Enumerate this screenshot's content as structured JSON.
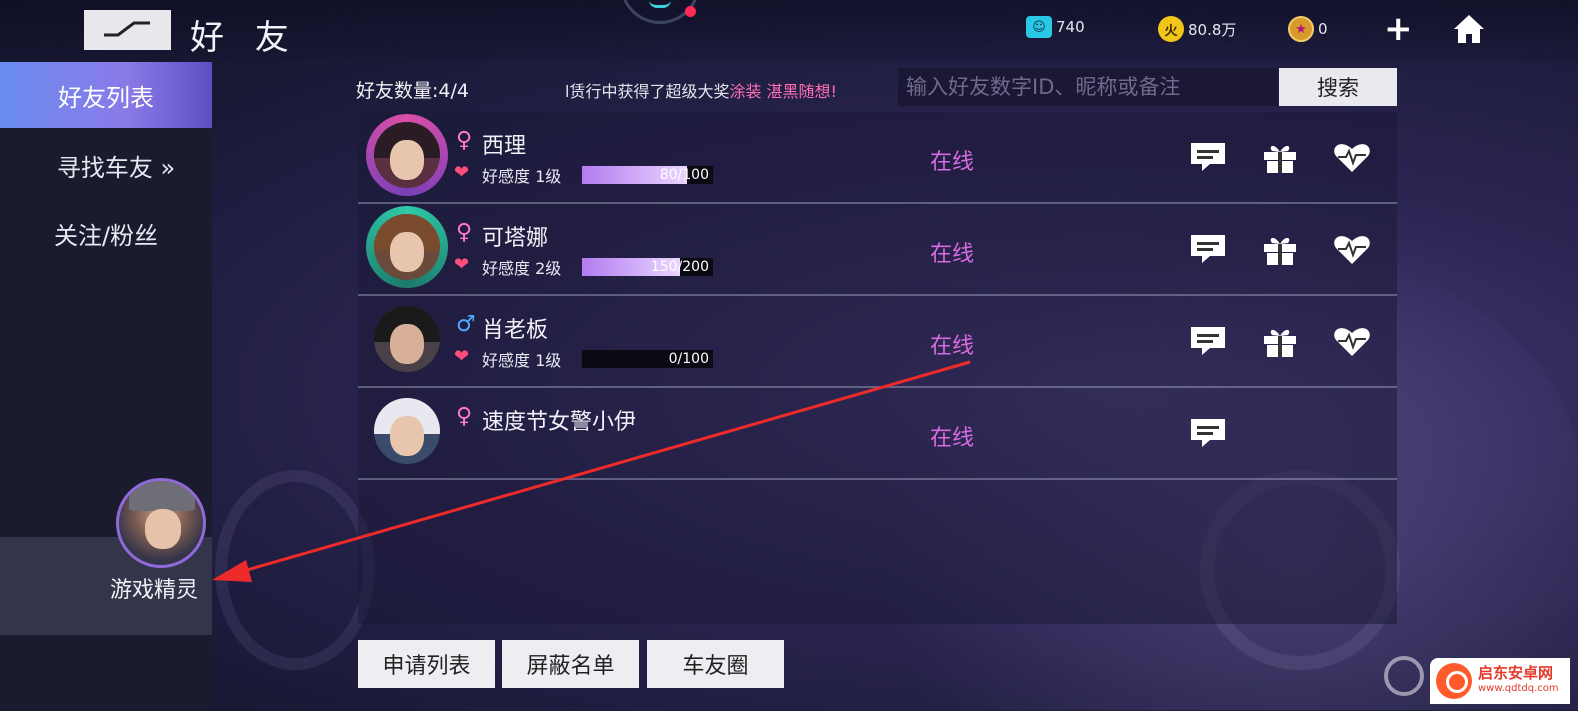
{
  "header": {
    "title": "好 友",
    "currencies": [
      {
        "icon": "ticket-icon",
        "value": "740"
      },
      {
        "icon": "gold-coin-icon",
        "value": "80.8万"
      },
      {
        "icon": "star-coin-icon",
        "value": "0"
      }
    ]
  },
  "sidebar": {
    "items": [
      {
        "label": "好友列表"
      },
      {
        "label": "寻找车友 »"
      },
      {
        "label": "关注/粉丝"
      }
    ],
    "sprite_label": "游戏精灵"
  },
  "main": {
    "count_label": "好友数量:4/4",
    "marquee_prefix": "l赁行中获得了超级大奖",
    "marquee_highlight": "涂装 湛黑随想!",
    "search_placeholder": "输入好友数字ID、昵称或备注",
    "search_button": "搜索",
    "friends": [
      {
        "gender": "♀",
        "name": "西理",
        "affinity_label": "好感度 1级",
        "affinity_text": "80/100",
        "affinity": 0.8,
        "status": "在线",
        "actions": [
          "chat",
          "gift",
          "heart"
        ]
      },
      {
        "gender": "♀",
        "name": "可塔娜",
        "affinity_label": "好感度 2级",
        "affinity_text": "150/200",
        "affinity": 0.75,
        "status": "在线",
        "actions": [
          "chat",
          "gift",
          "heart"
        ]
      },
      {
        "gender": "♂",
        "name": "肖老板",
        "affinity_label": "好感度 1级",
        "affinity_text": "0/100",
        "affinity": 0.0,
        "status": "在线",
        "actions": [
          "chat",
          "gift",
          "heart"
        ]
      },
      {
        "gender": "♀",
        "name": "速度节女警小伊",
        "status": "在线",
        "actions": [
          "chat"
        ]
      }
    ],
    "bottom_buttons": [
      "申请列表",
      "屏蔽名单",
      "车友圈"
    ]
  },
  "watermark": {
    "line1": "启东安卓网",
    "line2": "www.qdtdq.com"
  },
  "colors": {
    "accent": "#7a86ef",
    "online": "#d76be0",
    "female": "#ff7ac7",
    "male": "#4fa8ff"
  }
}
